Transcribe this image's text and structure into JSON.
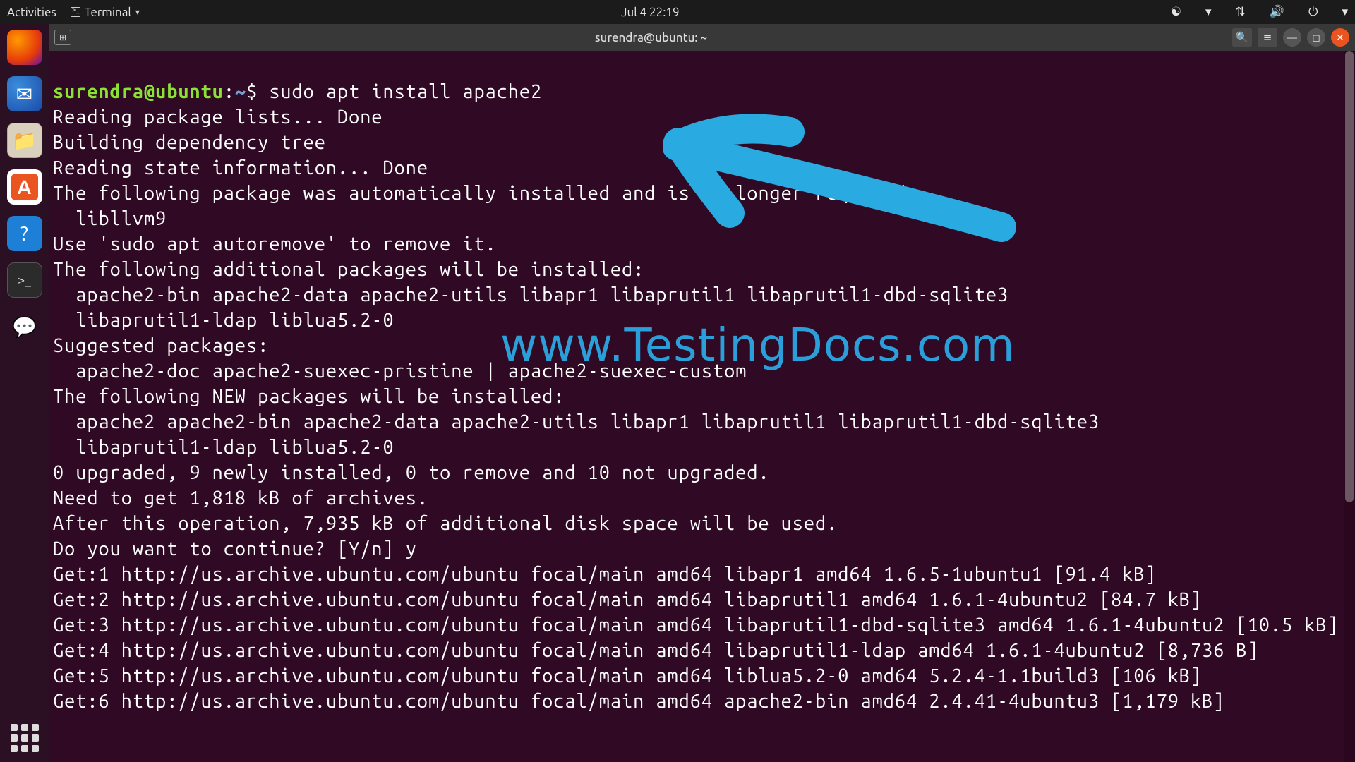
{
  "topbar": {
    "activities": "Activities",
    "terminal_menu": "Terminal",
    "clock": "Jul 4  22:19"
  },
  "dock": {
    "apps": [
      "firefox",
      "thunderbird",
      "files",
      "software",
      "help",
      "terminal",
      "hexchat"
    ]
  },
  "window": {
    "title": "surendra@ubuntu: ~"
  },
  "prompt": {
    "userhost": "surendra@ubuntu",
    "colon": ":",
    "path": "~",
    "dollar": "$",
    "command": "sudo apt install apache2"
  },
  "output_lines": [
    "Reading package lists... Done",
    "Building dependency tree",
    "Reading state information... Done",
    "The following package was automatically installed and is no longer required:",
    "  libllvm9",
    "Use 'sudo apt autoremove' to remove it.",
    "The following additional packages will be installed:",
    "  apache2-bin apache2-data apache2-utils libapr1 libaprutil1 libaprutil1-dbd-sqlite3",
    "  libaprutil1-ldap liblua5.2-0",
    "Suggested packages:",
    "  apache2-doc apache2-suexec-pristine | apache2-suexec-custom",
    "The following NEW packages will be installed:",
    "  apache2 apache2-bin apache2-data apache2-utils libapr1 libaprutil1 libaprutil1-dbd-sqlite3",
    "  libaprutil1-ldap liblua5.2-0",
    "0 upgraded, 9 newly installed, 0 to remove and 10 not upgraded.",
    "Need to get 1,818 kB of archives.",
    "After this operation, 7,935 kB of additional disk space will be used.",
    "Do you want to continue? [Y/n] y",
    "Get:1 http://us.archive.ubuntu.com/ubuntu focal/main amd64 libapr1 amd64 1.6.5-1ubuntu1 [91.4 kB]",
    "Get:2 http://us.archive.ubuntu.com/ubuntu focal/main amd64 libaprutil1 amd64 1.6.1-4ubuntu2 [84.7 kB]",
    "Get:3 http://us.archive.ubuntu.com/ubuntu focal/main amd64 libaprutil1-dbd-sqlite3 amd64 1.6.1-4ubuntu2 [10.5 kB]",
    "Get:4 http://us.archive.ubuntu.com/ubuntu focal/main amd64 libaprutil1-ldap amd64 1.6.1-4ubuntu2 [8,736 B]",
    "Get:5 http://us.archive.ubuntu.com/ubuntu focal/main amd64 liblua5.2-0 amd64 5.2.4-1.1build3 [106 kB]",
    "Get:6 http://us.archive.ubuntu.com/ubuntu focal/main amd64 apache2-bin amd64 2.4.41-4ubuntu3 [1,179 kB]"
  ],
  "watermark": "www.TestingDocs.com"
}
